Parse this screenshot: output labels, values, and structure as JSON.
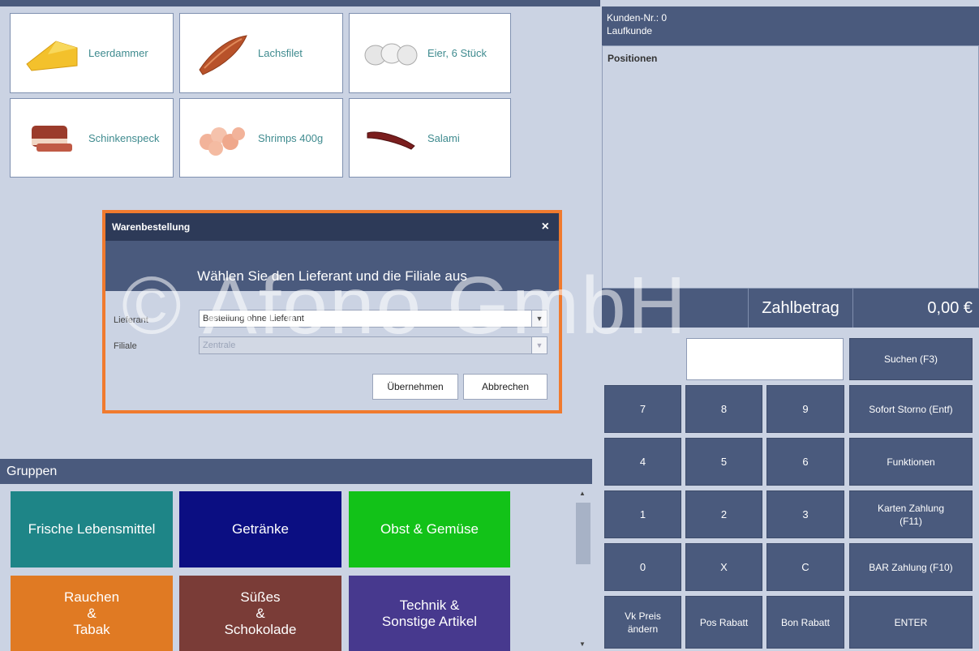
{
  "products": [
    {
      "label": "Leerdammer",
      "icon": "cheese-icon"
    },
    {
      "label": "Lachsfilet",
      "icon": "salmon-icon"
    },
    {
      "label": "Eier, 6 Stück",
      "icon": "eggs-icon"
    },
    {
      "label": "Schinkenspeck",
      "icon": "bacon-icon"
    },
    {
      "label": "Shrimps 400g",
      "icon": "shrimps-icon"
    },
    {
      "label": "Salami",
      "icon": "salami-icon"
    }
  ],
  "customer": {
    "number_line": "Kunden-Nr.: 0",
    "name": "Laufkunde"
  },
  "positions_label": "Positionen",
  "total": {
    "label": "Zahlbetrag",
    "amount": "0,00 €"
  },
  "keypad": {
    "search": "Suchen (F3)",
    "k7": "7",
    "k8": "8",
    "k9": "9",
    "storno": "Sofort Storno (Entf)",
    "k4": "4",
    "k5": "5",
    "k6": "6",
    "functions": "Funktionen",
    "k1": "1",
    "k2": "2",
    "k3": "3",
    "card": "Karten Zahlung\n(F11)",
    "k0": "0",
    "kx": "X",
    "kc": "C",
    "cash": "BAR Zahlung (F10)",
    "vk_price": "Vk Preis\nändern",
    "pos_discount": "Pos Rabatt",
    "bon_discount": "Bon Rabatt",
    "enter": "ENTER"
  },
  "groups_label": "Gruppen",
  "groups": [
    {
      "label": "Frische Lebensmittel",
      "color": "#1e8587"
    },
    {
      "label": "Getränke",
      "color": "#0b0e82"
    },
    {
      "label": "Obst & Gemüse",
      "color": "#12c218"
    },
    {
      "label": "Rauchen\n&\nTabak",
      "color": "#e07a23"
    },
    {
      "label": "Süßes\n&\nSchokolade",
      "color": "#7a3c37"
    },
    {
      "label": "Technik &\nSonstige Artikel",
      "color": "#47398e"
    }
  ],
  "dialog": {
    "title": "Warenbestellung",
    "close": "×",
    "heading": "Wählen Sie den Lieferant und die Filiale aus",
    "supplier_label": "Lieferant",
    "supplier_value": "Bestellung ohne Lieferant",
    "branch_label": "Filiale",
    "branch_value": "Zentrale",
    "apply": "Übernehmen",
    "cancel": "Abbrechen"
  },
  "watermark": "© Afono GmbH",
  "colors": {
    "panel": "#4a5a7d",
    "background": "#cbd3e3",
    "dialog_border": "#f07a2e"
  }
}
